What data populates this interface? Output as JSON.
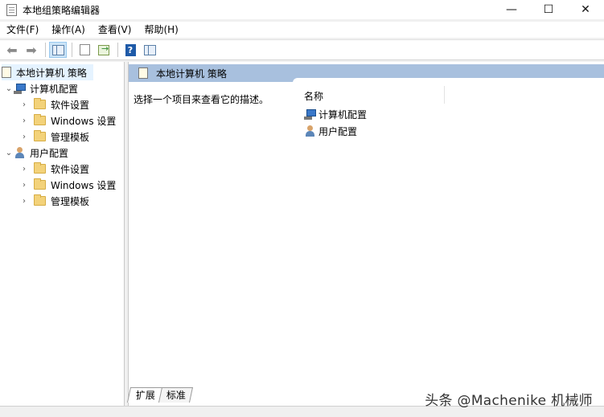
{
  "window": {
    "title": "本地组策略编辑器",
    "controls": {
      "minimize": "—",
      "maximize": "☐",
      "close": "✕"
    }
  },
  "menubar": {
    "items": [
      "文件(F)",
      "操作(A)",
      "查看(V)",
      "帮助(H)"
    ]
  },
  "toolbar": {
    "icons": [
      "back-arrow-icon",
      "forward-arrow-icon",
      "show-hide-tree-icon",
      "properties-icon",
      "export-list-icon",
      "help-icon",
      "action-pane-icon"
    ]
  },
  "tree": {
    "root": "本地计算机 策略",
    "computer_config": {
      "label": "计算机配置",
      "children": [
        "软件设置",
        "Windows 设置",
        "管理模板"
      ]
    },
    "user_config": {
      "label": "用户配置",
      "children": [
        "软件设置",
        "Windows 设置",
        "管理模板"
      ]
    }
  },
  "right_pane": {
    "header": "本地计算机 策略",
    "description": "选择一个项目来查看它的描述。",
    "column_name": "名称",
    "items": [
      "计算机配置",
      "用户配置"
    ]
  },
  "tabs": [
    "扩展",
    "标准"
  ],
  "watermark": "头条 @Machenike 机械师",
  "colors": {
    "header_bg": "#a8c0de",
    "selected_bg": "#e5f3ff"
  }
}
